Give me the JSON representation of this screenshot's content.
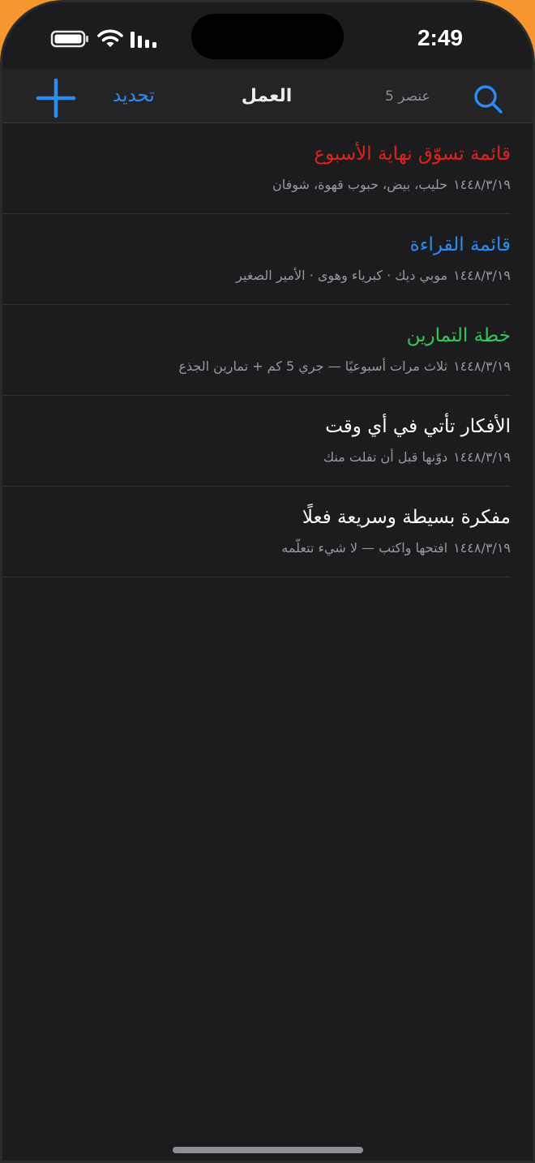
{
  "status_bar": {
    "time": "2:49",
    "battery_icon": "battery-icon",
    "wifi_icon": "wifi-icon",
    "signal_icon": "signal-icon"
  },
  "nav": {
    "add_icon": "plus-icon",
    "refresh_label": "تحديد",
    "title": "العمل",
    "item_count": "5 عنصر",
    "search_icon": "search-icon"
  },
  "colors": {
    "accent": "#2d8cf0",
    "background": "#1c1c1e",
    "title_red": "#e0241b",
    "title_blue": "#2d8cf0",
    "title_green": "#34c759",
    "title_white": "#ffffff"
  },
  "notes": [
    {
      "title": "قائمة تسوّق نهاية الأسبوع",
      "date": "١٤٤٨/٣/١٩",
      "preview": "حليب، بيض، حبوب قهوة، شوفان",
      "title_color": "#e0241b"
    },
    {
      "title": "قائمة القراءة",
      "date": "١٤٤٨/٣/١٩",
      "preview": "موبي ديك · كبرياء وهوى · الأمير الصغير",
      "title_color": "#2d8cf0"
    },
    {
      "title": "خطة التمارين",
      "date": "١٤٤٨/٣/١٩",
      "preview": "ثلاث مرات أسبوعيًا — جري 5 كم + تمارين الجذع",
      "title_color": "#34c759"
    },
    {
      "title": "الأفكار تأتي في أي وقت",
      "date": "١٤٤٨/٣/١٩",
      "preview": "دوّنها قبل أن تفلت منك",
      "title_color": "#ffffff"
    },
    {
      "title": "مفكرة بسيطة وسريعة فعلًا",
      "date": "١٤٤٨/٣/١٩",
      "preview": "افتحها واكتب — لا شيء تتعلّمه",
      "title_color": "#ffffff"
    }
  ]
}
